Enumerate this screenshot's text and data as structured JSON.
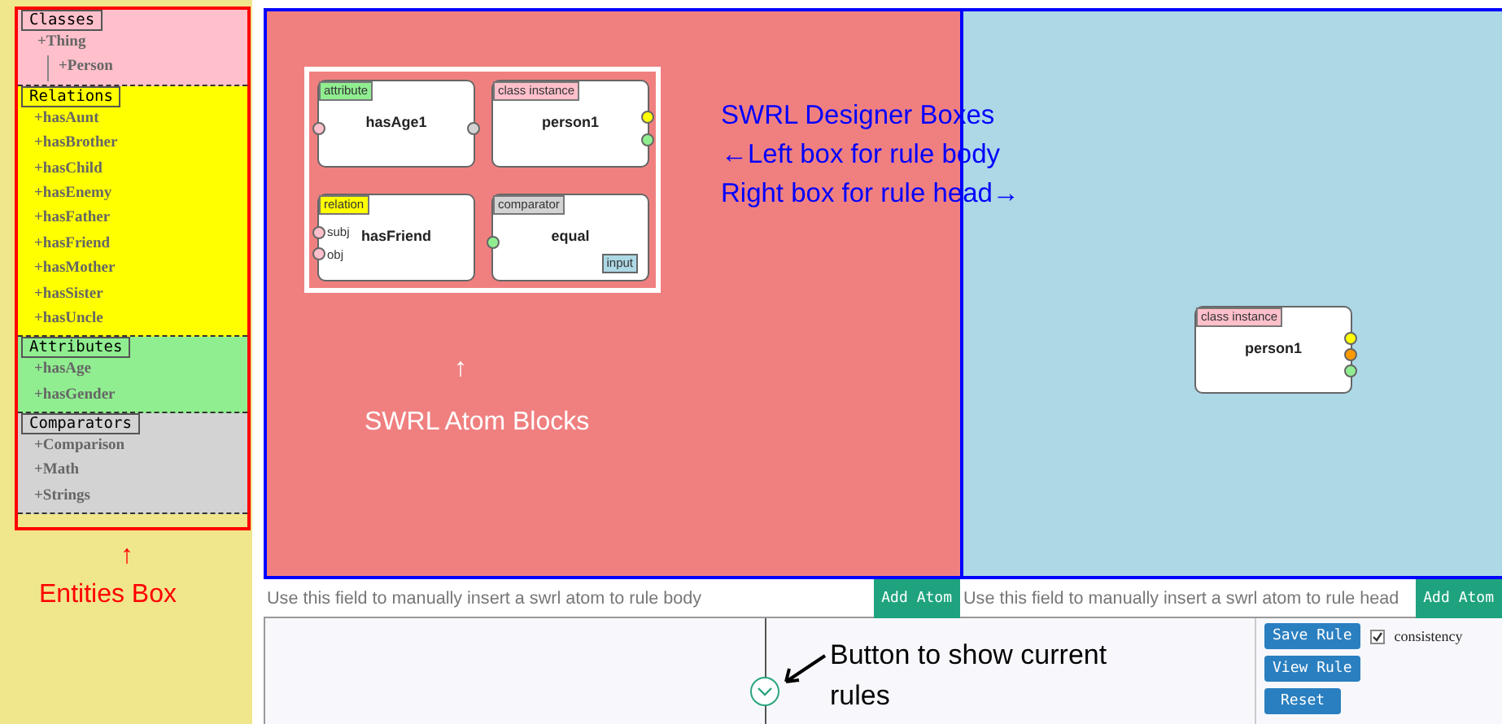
{
  "entities": {
    "sections": [
      {
        "title": "Classes",
        "color": "#ffc0cb",
        "items": [
          {
            "label": "+Thing",
            "children": [
              {
                "label": "+Person"
              }
            ]
          }
        ]
      },
      {
        "title": "Relations",
        "color": "#ffff00",
        "items": [
          {
            "label": "+hasAunt"
          },
          {
            "label": "+hasBrother"
          },
          {
            "label": "+hasChild"
          },
          {
            "label": "+hasEnemy"
          },
          {
            "label": "+hasFather"
          },
          {
            "label": "+hasFriend"
          },
          {
            "label": "+hasMother"
          },
          {
            "label": "+hasSister"
          },
          {
            "label": "+hasUncle"
          }
        ]
      },
      {
        "title": "Attributes",
        "color": "#90ee90",
        "items": [
          {
            "label": "+hasAge"
          },
          {
            "label": "+hasGender"
          }
        ]
      },
      {
        "title": "Comparators",
        "color": "#d3d3d3",
        "items": [
          {
            "label": "+Comparison"
          },
          {
            "label": "+Math"
          },
          {
            "label": "+Strings"
          }
        ]
      }
    ]
  },
  "body_canvas": {
    "palette": [
      {
        "category": "attribute",
        "color": "#90ee90",
        "name": "hasAge1",
        "left_ports": [
          {
            "color": "#ffc0cb"
          }
        ],
        "right_ports": [
          {
            "color": "#d3d3d3"
          }
        ]
      },
      {
        "category": "class instance",
        "color": "#ffc0cb",
        "name": "person1",
        "right_ports": [
          {
            "color": "#ffff00"
          },
          {
            "color": "#90ee90"
          }
        ]
      },
      {
        "category": "relation",
        "color": "#ffff00",
        "name": "hasFriend",
        "left_ports": [
          {
            "color": "#ffc0cb",
            "label": "subj"
          },
          {
            "color": "#ffc0cb",
            "label": "obj"
          }
        ]
      },
      {
        "category": "comparator",
        "color": "#d3d3d3",
        "name": "equal",
        "badge": "input",
        "left_ports": [
          {
            "color": "#90ee90"
          }
        ]
      }
    ]
  },
  "head_canvas": {
    "nodes": [
      {
        "category": "class instance",
        "color": "#ffc0cb",
        "name": "person1",
        "right_ports": [
          {
            "color": "#ffff00"
          },
          {
            "color": "#ff9900"
          },
          {
            "color": "#90ee90"
          }
        ]
      }
    ]
  },
  "atom_inputs": [
    {
      "placeholder": "Use this field to manually insert a swrl atom to rule body",
      "button": "Add Atom"
    },
    {
      "placeholder": "Use this field to manually insert a swrl atom to rule head",
      "button": "Add Atom"
    }
  ],
  "rule_controls": {
    "save": "Save Rule",
    "consistency": {
      "label": "consistency",
      "checked": true
    },
    "view": "View Rule",
    "reset": "Reset"
  },
  "annotations": [
    {
      "kind": "canvases",
      "color": "#0000ff",
      "lines": [
        "SWRL Designer Boxes",
        "←Left box for rule body",
        "Right box for rule head→"
      ]
    },
    {
      "kind": "palette",
      "color": "#ffffff",
      "lines": [
        "↑",
        "SWRL Atom Blocks"
      ]
    },
    {
      "kind": "entities",
      "color": "#ff0000",
      "lines": [
        "↑",
        "Entities Box"
      ]
    },
    {
      "kind": "rules-button",
      "color": "#000000",
      "lines": [
        "Button to show current",
        "rules"
      ]
    }
  ]
}
